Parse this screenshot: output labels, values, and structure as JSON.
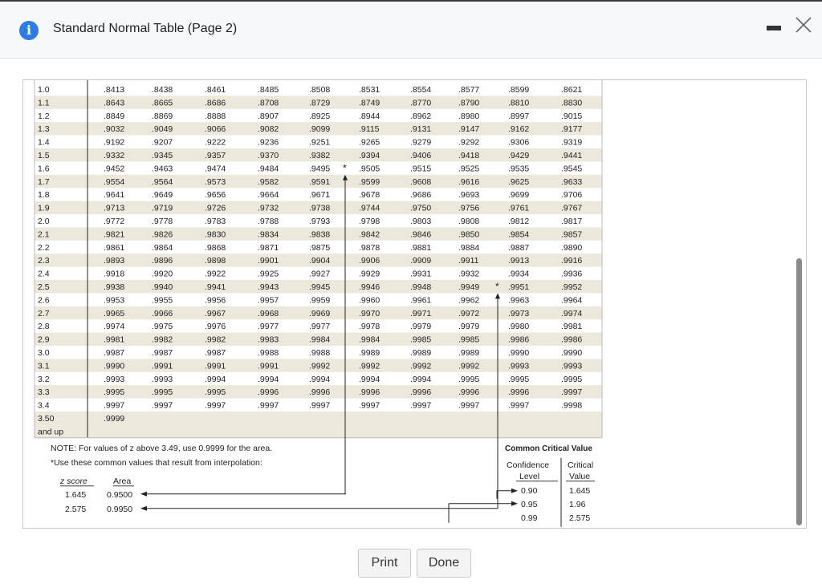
{
  "dialog": {
    "title": "Standard Normal Table (Page 2)",
    "icon": "info-icon",
    "accent": "#2d7be5"
  },
  "table": {
    "rows": [
      {
        "z": "1.0",
        "v": [
          ".8413",
          ".8438",
          ".8461",
          ".8485",
          ".8508",
          ".8531",
          ".8554",
          ".8577",
          ".8599",
          ".8621"
        ]
      },
      {
        "z": "1.1",
        "v": [
          ".8643",
          ".8665",
          ".8686",
          ".8708",
          ".8729",
          ".8749",
          ".8770",
          ".8790",
          ".8810",
          ".8830"
        ]
      },
      {
        "z": "1.2",
        "v": [
          ".8849",
          ".8869",
          ".8888",
          ".8907",
          ".8925",
          ".8944",
          ".8962",
          ".8980",
          ".8997",
          ".9015"
        ]
      },
      {
        "z": "1.3",
        "v": [
          ".9032",
          ".9049",
          ".9066",
          ".9082",
          ".9099",
          ".9115",
          ".9131",
          ".9147",
          ".9162",
          ".9177"
        ]
      },
      {
        "z": "1.4",
        "v": [
          ".9192",
          ".9207",
          ".9222",
          ".9236",
          ".9251",
          ".9265",
          ".9279",
          ".9292",
          ".9306",
          ".9319"
        ]
      },
      {
        "z": "1.5",
        "v": [
          ".9332",
          ".9345",
          ".9357",
          ".9370",
          ".9382",
          ".9394",
          ".9406",
          ".9418",
          ".9429",
          ".9441"
        ]
      },
      {
        "z": "1.6",
        "v": [
          ".9452",
          ".9463",
          ".9474",
          ".9484",
          ".9495",
          ".9505",
          ".9515",
          ".9525",
          ".9535",
          ".9545"
        ]
      },
      {
        "z": "1.7",
        "v": [
          ".9554",
          ".9564",
          ".9573",
          ".9582",
          ".9591",
          ".9599",
          ".9608",
          ".9616",
          ".9625",
          ".9633"
        ]
      },
      {
        "z": "1.8",
        "v": [
          ".9641",
          ".9649",
          ".9656",
          ".9664",
          ".9671",
          ".9678",
          ".9686",
          ".9693",
          ".9699",
          ".9706"
        ]
      },
      {
        "z": "1.9",
        "v": [
          ".9713",
          ".9719",
          ".9726",
          ".9732",
          ".9738",
          ".9744",
          ".9750",
          ".9756",
          ".9761",
          ".9767"
        ]
      },
      {
        "z": "2.0",
        "v": [
          ".9772",
          ".9778",
          ".9783",
          ".9788",
          ".9793",
          ".9798",
          ".9803",
          ".9808",
          ".9812",
          ".9817"
        ]
      },
      {
        "z": "2.1",
        "v": [
          ".9821",
          ".9826",
          ".9830",
          ".9834",
          ".9838",
          ".9842",
          ".9846",
          ".9850",
          ".9854",
          ".9857"
        ]
      },
      {
        "z": "2.2",
        "v": [
          ".9861",
          ".9864",
          ".9868",
          ".9871",
          ".9875",
          ".9878",
          ".9881",
          ".9884",
          ".9887",
          ".9890"
        ]
      },
      {
        "z": "2.3",
        "v": [
          ".9893",
          ".9896",
          ".9898",
          ".9901",
          ".9904",
          ".9906",
          ".9909",
          ".9911",
          ".9913",
          ".9916"
        ]
      },
      {
        "z": "2.4",
        "v": [
          ".9918",
          ".9920",
          ".9922",
          ".9925",
          ".9927",
          ".9929",
          ".9931",
          ".9932",
          ".9934",
          ".9936"
        ]
      },
      {
        "z": "2.5",
        "v": [
          ".9938",
          ".9940",
          ".9941",
          ".9943",
          ".9945",
          ".9946",
          ".9948",
          ".9949",
          ".9951",
          ".9952"
        ]
      },
      {
        "z": "2.6",
        "v": [
          ".9953",
          ".9955",
          ".9956",
          ".9957",
          ".9959",
          ".9960",
          ".9961",
          ".9962",
          ".9963",
          ".9964"
        ]
      },
      {
        "z": "2.7",
        "v": [
          ".9965",
          ".9966",
          ".9967",
          ".9968",
          ".9969",
          ".9970",
          ".9971",
          ".9972",
          ".9973",
          ".9974"
        ]
      },
      {
        "z": "2.8",
        "v": [
          ".9974",
          ".9975",
          ".9976",
          ".9977",
          ".9977",
          ".9978",
          ".9979",
          ".9979",
          ".9980",
          ".9981"
        ]
      },
      {
        "z": "2.9",
        "v": [
          ".9981",
          ".9982",
          ".9982",
          ".9983",
          ".9984",
          ".9984",
          ".9985",
          ".9985",
          ".9986",
          ".9986"
        ]
      },
      {
        "z": "3.0",
        "v": [
          ".9987",
          ".9987",
          ".9987",
          ".9988",
          ".9988",
          ".9989",
          ".9989",
          ".9989",
          ".9990",
          ".9990"
        ]
      },
      {
        "z": "3.1",
        "v": [
          ".9990",
          ".9991",
          ".9991",
          ".9991",
          ".9992",
          ".9992",
          ".9992",
          ".9992",
          ".9993",
          ".9993"
        ]
      },
      {
        "z": "3.2",
        "v": [
          ".9993",
          ".9993",
          ".9994",
          ".9994",
          ".9994",
          ".9994",
          ".9994",
          ".9995",
          ".9995",
          ".9995"
        ]
      },
      {
        "z": "3.3",
        "v": [
          ".9995",
          ".9995",
          ".9995",
          ".9996",
          ".9996",
          ".9996",
          ".9996",
          ".9996",
          ".9996",
          ".9997"
        ]
      },
      {
        "z": "3.4",
        "v": [
          ".9997",
          ".9997",
          ".9997",
          ".9997",
          ".9997",
          ".9997",
          ".9997",
          ".9997",
          ".9997",
          ".9998"
        ]
      }
    ],
    "last_row_z_line1": "3.50",
    "last_row_z_line2": "and up",
    "last_row_value": ".9999",
    "stripe_color": "#ece8db",
    "interp_markers": [
      "*",
      "*"
    ]
  },
  "note": {
    "line1": "NOTE: For values of z above 3.49, use 0.9999 for the area.",
    "line2": "*Use these common values that result from interpolation:",
    "col_header_z": "z score",
    "col_header_area": "Area",
    "rows": [
      {
        "z": "1.645",
        "area": "0.9500"
      },
      {
        "z": "2.575",
        "area": "0.9950"
      }
    ]
  },
  "critical": {
    "title": "Common Critical Value",
    "header_conf_line1": "Confidence",
    "header_conf_line2": "Level",
    "header_crit_line1": "Critical",
    "header_crit_line2": "Value",
    "rows": [
      {
        "level": "0.90",
        "value": "1.645"
      },
      {
        "level": "0.95",
        "value": "1.96"
      },
      {
        "level": "0.99",
        "value": "2.575"
      }
    ]
  },
  "footer": {
    "print_label": "Print",
    "done_label": "Done"
  }
}
